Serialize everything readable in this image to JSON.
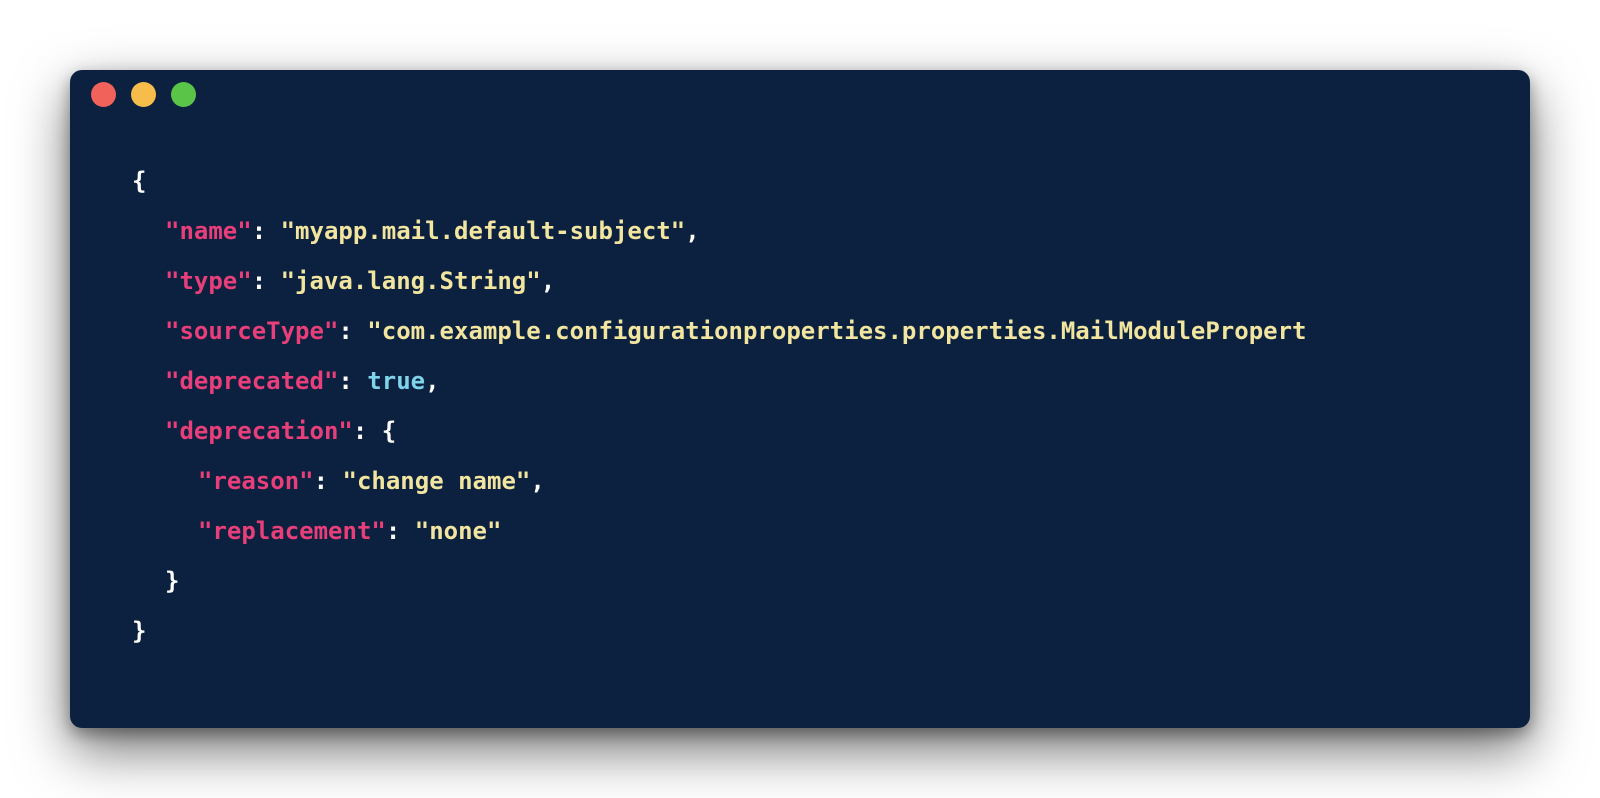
{
  "colors": {
    "page_background": "#ffffff",
    "window_background": "#0b213f",
    "close": "#f0625a",
    "minimize": "#f7bd4a",
    "maximize": "#5ac448",
    "punctuation": "#ffffff",
    "key": "#e83e79",
    "string": "#f2e5a0",
    "literal": "#7fd3ea"
  },
  "window": {
    "controls": [
      {
        "name": "close-button",
        "color": "#f0625a"
      },
      {
        "name": "minimize-button",
        "color": "#f7bd4a"
      },
      {
        "name": "maximize-button",
        "color": "#5ac448"
      }
    ]
  },
  "code": {
    "lines": [
      {
        "indent": 0,
        "tokens": [
          {
            "t": "p",
            "v": "{"
          }
        ]
      },
      {
        "indent": 1,
        "tokens": [
          {
            "t": "k",
            "v": "\"name\""
          },
          {
            "t": "p",
            "v": ": "
          },
          {
            "t": "s",
            "v": "\"myapp.mail.default-subject\""
          },
          {
            "t": "p",
            "v": ","
          }
        ]
      },
      {
        "indent": 1,
        "tokens": [
          {
            "t": "k",
            "v": "\"type\""
          },
          {
            "t": "p",
            "v": ": "
          },
          {
            "t": "s",
            "v": "\"java.lang.String\""
          },
          {
            "t": "p",
            "v": ","
          }
        ]
      },
      {
        "indent": 1,
        "tokens": [
          {
            "t": "k",
            "v": "\"sourceType\""
          },
          {
            "t": "p",
            "v": ": "
          },
          {
            "t": "s",
            "v": "\"com.example.configurationproperties.properties.MailModulePropert"
          }
        ]
      },
      {
        "indent": 1,
        "tokens": [
          {
            "t": "k",
            "v": "\"deprecated\""
          },
          {
            "t": "p",
            "v": ": "
          },
          {
            "t": "l",
            "v": "true"
          },
          {
            "t": "p",
            "v": ","
          }
        ]
      },
      {
        "indent": 1,
        "tokens": [
          {
            "t": "k",
            "v": "\"deprecation\""
          },
          {
            "t": "p",
            "v": ": {"
          }
        ]
      },
      {
        "indent": 2,
        "tokens": [
          {
            "t": "k",
            "v": "\"reason\""
          },
          {
            "t": "p",
            "v": ": "
          },
          {
            "t": "s",
            "v": "\"change name\""
          },
          {
            "t": "p",
            "v": ","
          }
        ]
      },
      {
        "indent": 2,
        "tokens": [
          {
            "t": "k",
            "v": "\"replacement\""
          },
          {
            "t": "p",
            "v": ": "
          },
          {
            "t": "s",
            "v": "\"none\""
          }
        ]
      },
      {
        "indent": 1,
        "tokens": [
          {
            "t": "p",
            "v": "}"
          }
        ]
      },
      {
        "indent": 0,
        "tokens": [
          {
            "t": "p",
            "v": "}"
          }
        ]
      }
    ]
  }
}
